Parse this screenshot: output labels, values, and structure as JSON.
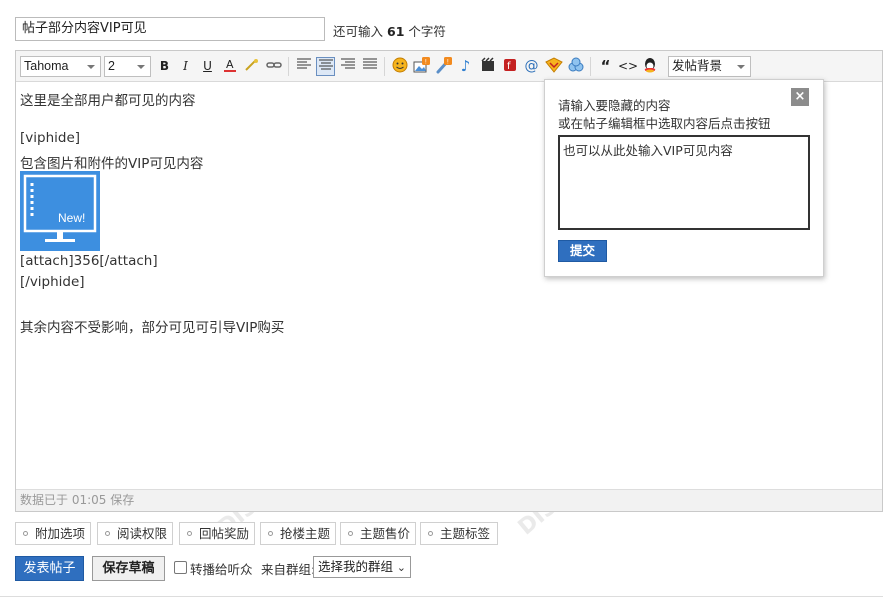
{
  "title": {
    "value": "帖子部分内容VIP可见",
    "remain_prefix": "还可输入",
    "remain_count": "61",
    "remain_suffix": "个字符"
  },
  "toolbar": {
    "font_family": "Tahoma",
    "font_size": "2",
    "bold": "B",
    "italic": "I",
    "underline": "U",
    "quote": "“",
    "code": "<>",
    "at": "@",
    "background_select": "发帖背景",
    "icons": [
      "bold-icon",
      "italic-icon",
      "underline-icon",
      "font-color-icon",
      "spellcheck-icon",
      "link-icon",
      "align-left-icon",
      "align-center-icon",
      "align-right-icon",
      "align-justify-icon",
      "smiley-icon",
      "image-icon",
      "attachment-icon",
      "music-icon",
      "video-icon",
      "flash-icon",
      "at-icon",
      "vip-icon",
      "group-icon",
      "quote-icon",
      "code-icon",
      "qq-icon"
    ]
  },
  "editor": {
    "lines": [
      "这里是全部用户都可见的内容",
      "[viphide]",
      "包含图片和附件的VIP可见内容",
      "[attach]356[/attach]",
      "[/viphide]",
      "其余内容不受影响，部分可见可引导VIP购买"
    ],
    "thumb_badge": "New!",
    "status": "数据已于 01:05 保存"
  },
  "popup": {
    "tip1": "请输入要隐藏的内容",
    "tip2": "或在帖子编辑框中选取内容后点击按钮",
    "close": "×",
    "text": "也可以从此处输入VIP可见内容",
    "submit": "提交"
  },
  "options": [
    "附加选项",
    "阅读权限",
    "回帖奖励",
    "抢楼主题",
    "主题售价",
    "主题标签"
  ],
  "bottom": {
    "publish": "发表帖子",
    "draft": "保存草稿",
    "broadcast": "转播给听众",
    "group_label": "来自群组:",
    "group_select": "选择我的群组",
    "chevron": "⌄"
  },
  "watermark": "DISCUZ!应用中心 | 贰道",
  "colors": {
    "primary": "#2f6fbf",
    "thumb": "#3d8fe0"
  }
}
